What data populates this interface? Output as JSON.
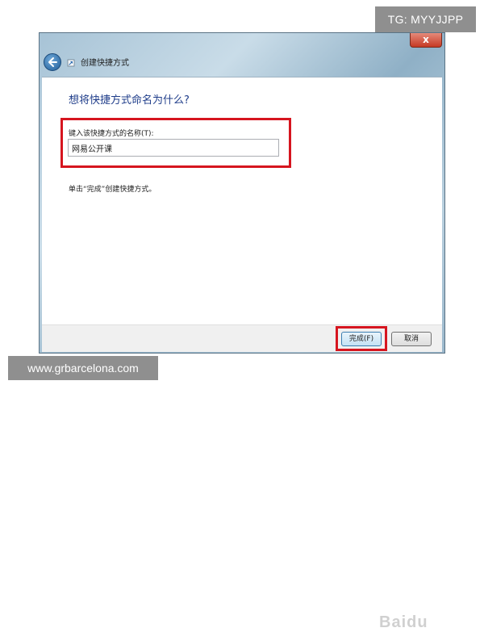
{
  "watermarks": {
    "top": "TG: MYYJJPP",
    "bottom": "www.grbarcelona.com",
    "overlay": "Baidu"
  },
  "window": {
    "title": "创建快捷方式",
    "close_label": "x",
    "icons": {
      "back": "back-arrow-icon",
      "wizard": "shortcut-wizard-icon"
    }
  },
  "content": {
    "heading": "想将快捷方式命名为什么?",
    "name_label": "键入该快捷方式的名称(T):",
    "name_value": "网易公开课",
    "hint": "单击“完成”创建快捷方式。"
  },
  "footer": {
    "finish_label": "完成(F)",
    "cancel_label": "取消"
  },
  "colors": {
    "highlight": "#d6151f",
    "heading": "#1f3d8a",
    "close_button": "#c53a24"
  }
}
